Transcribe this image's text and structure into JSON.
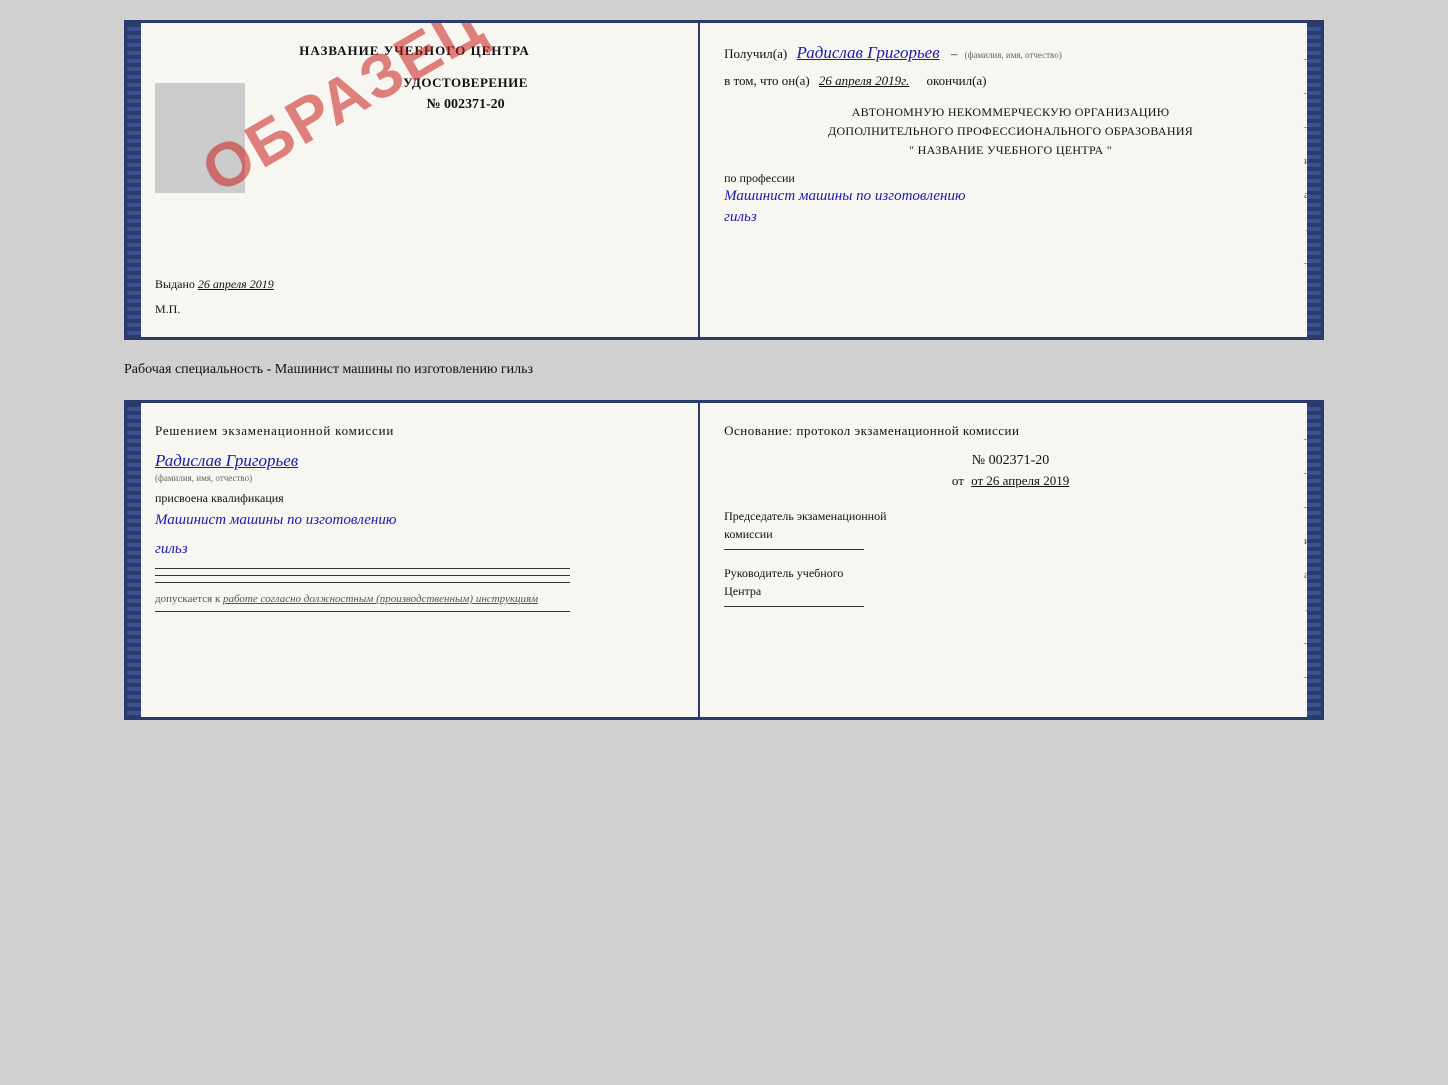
{
  "topCert": {
    "left": {
      "centerTitle": "НАЗВАНИЕ УЧЕБНОГО ЦЕНТРА",
      "stampText": "ОБРАЗЕЦ",
      "udostTitle": "УДОСТОВЕРЕНИЕ",
      "udostNumber": "№ 002371-20",
      "vydanoLabel": "Выдано",
      "vydanoDate": "26 апреля 2019",
      "mpLabel": "М.П."
    },
    "right": {
      "poluchilLabel": "Получил(а)",
      "personName": "Радислав Григорьев",
      "fioLabel": "(фамилия, имя, отчество)",
      "vTomLabel": "в том, что он(а)",
      "completionDate": "26 апреля 2019г.",
      "okonchilLabel": "окончил(а)",
      "orgLine1": "АВТОНОМНУЮ НЕКОММЕРЧЕСКУЮ ОРГАНИЗАЦИЮ",
      "orgLine2": "ДОПОЛНИТЕЛЬНОГО ПРОФЕССИОНАЛЬНОГО ОБРАЗОВАНИЯ",
      "orgLine3": "\"  НАЗВАНИЕ УЧЕБНОГО ЦЕНТРА  \"",
      "poProfessiiLabel": "по профессии",
      "professionText": "Машинист машины по изготовлению",
      "professionText2": "гильз",
      "edgeMarks": [
        "-",
        "-",
        "-",
        "и",
        "а",
        "←",
        "-",
        "-",
        "-"
      ]
    }
  },
  "middleLabel": "Рабочая специальность - Машинист машины по изготовлению гильз",
  "bottomCert": {
    "left": {
      "resheniemTitle": "Решением  экзаменационной  комиссии",
      "personName": "Радислав Григорьев",
      "fioLabel": "(фамилия, имя, отчество)",
      "prisvoenLabel": "присвоена квалификация",
      "qualificationText": "Машинист машины по изготовлению",
      "qualificationText2": "гильз",
      "dopuskaetsyaLabel": "допускается к",
      "workText": "работе согласно должностным (производственным) инструкциям"
    },
    "right": {
      "osnovanieTitlePart1": "Основание: протокол экзаменационной  комиссии",
      "protocolNumber": "№  002371-20",
      "otDate": "от 26 апреля 2019",
      "predsedatelTitle": "Председатель экзаменационной",
      "predsedatelTitle2": "комиссии",
      "rukovoditelTitle": "Руководитель учебного",
      "rukovoditelTitle2": "Центра",
      "edgeMarks": [
        "-",
        "-",
        "-",
        "и",
        "а",
        "←",
        "-",
        "-",
        "-"
      ]
    }
  }
}
